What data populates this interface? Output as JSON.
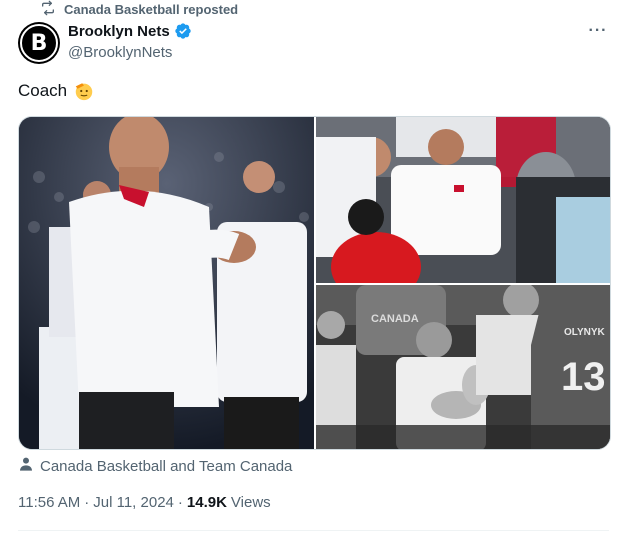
{
  "repost": {
    "label": "Canada Basketball reposted",
    "icon": "repost-icon"
  },
  "author": {
    "display_name": "Brooklyn Nets",
    "handle": "@BrooklynNets",
    "avatar_letter": "B",
    "verified_icon": "verified-badge-icon",
    "verified_color": "#1d9bf0"
  },
  "more_icon": "···",
  "tweet": {
    "text": "Coach",
    "emoji": "saluting-face-emoji"
  },
  "media": {
    "images": [
      {
        "name": "media-image-coach-clapping"
      },
      {
        "name": "media-image-coach-sideline"
      },
      {
        "name": "media-image-team-huddle",
        "visible_text": [
          "CANADA",
          "OLYNYK",
          "13"
        ]
      }
    ]
  },
  "tagged": {
    "label": "Canada Basketball and Team Canada",
    "icon": "person-icon"
  },
  "meta": {
    "time": "11:56 AM",
    "separator": "·",
    "date": "Jul 11, 2024",
    "views_count": "14.9K",
    "views_label": "Views"
  }
}
